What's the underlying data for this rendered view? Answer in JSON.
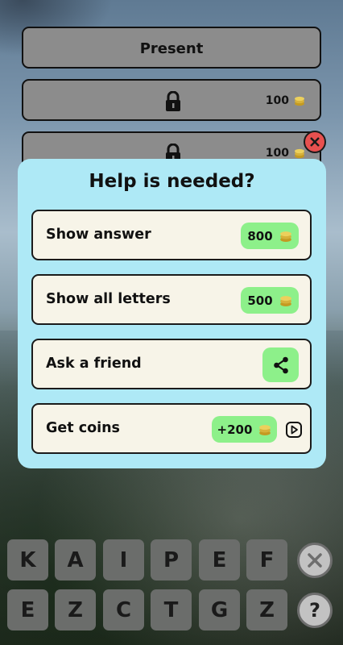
{
  "options": {
    "present_label": "Present",
    "locked": [
      {
        "price": "100"
      },
      {
        "price": "100"
      }
    ]
  },
  "dialog": {
    "title": "Help is needed?",
    "rows": [
      {
        "label": "Show answer",
        "price": "800"
      },
      {
        "label": "Show all letters",
        "price": "500"
      },
      {
        "label": "Ask a friend",
        "icon": "share-icon"
      },
      {
        "label": "Get coins",
        "price": "+200",
        "icon": "video-play-icon"
      }
    ]
  },
  "keyboard": {
    "row1": [
      "K",
      "A",
      "I",
      "P",
      "E",
      "F"
    ],
    "row2": [
      "E",
      "Z",
      "C",
      "T",
      "G",
      "Z"
    ],
    "clear_icon": "close-circle-icon",
    "hint_label": "?"
  },
  "colors": {
    "dialog_bg": "#aee9f6",
    "pill_green": "#8df08a",
    "close_red": "#e8504f",
    "coin_gold": "#e3c24a"
  }
}
